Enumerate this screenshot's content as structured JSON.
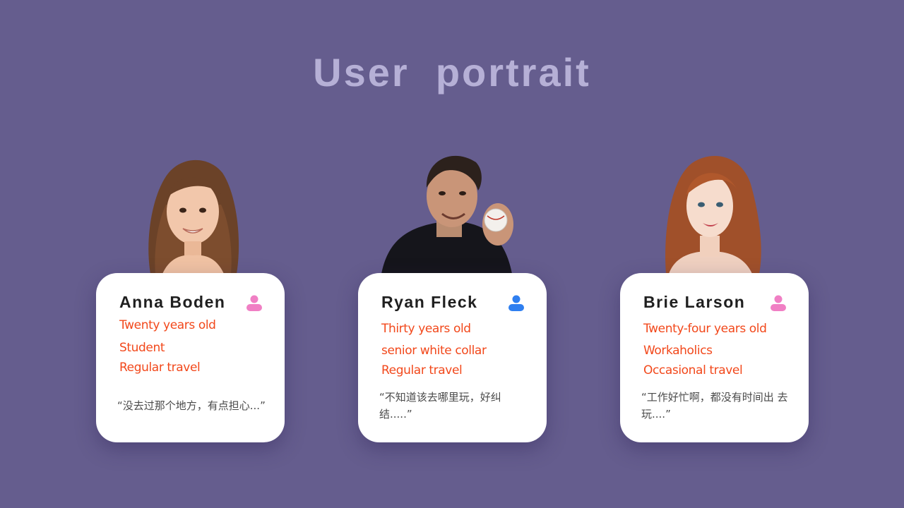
{
  "title": "User  portrait",
  "colors": {
    "background": "#655d8e",
    "title": "#b6b0d6",
    "card": "#ffffff",
    "attribute_text": "#f2481b",
    "quote_text": "#4a4a4a",
    "female_icon": "#f07fc4",
    "male_icon": "#2f7ff0"
  },
  "users": [
    {
      "name": "Anna Boden",
      "icon": "female-person-icon",
      "attributes": [
        "Twenty years old",
        "Student",
        "Regular travel"
      ],
      "quote": "“没去过那个地方，有点担心...”"
    },
    {
      "name": "Ryan Fleck",
      "icon": "male-person-icon",
      "attributes": [
        "Thirty  years old",
        "senior  white collar",
        "Regular travel"
      ],
      "quote": "“不知道该去哪里玩，好纠 结.....”"
    },
    {
      "name": "Brie Larson",
      "icon": "female-person-icon",
      "attributes": [
        "Twenty-four years old",
        "Workaholics",
        "Occasional travel"
      ],
      "quote": "“工作好忙啊，都没有时间出 去玩....”"
    }
  ]
}
